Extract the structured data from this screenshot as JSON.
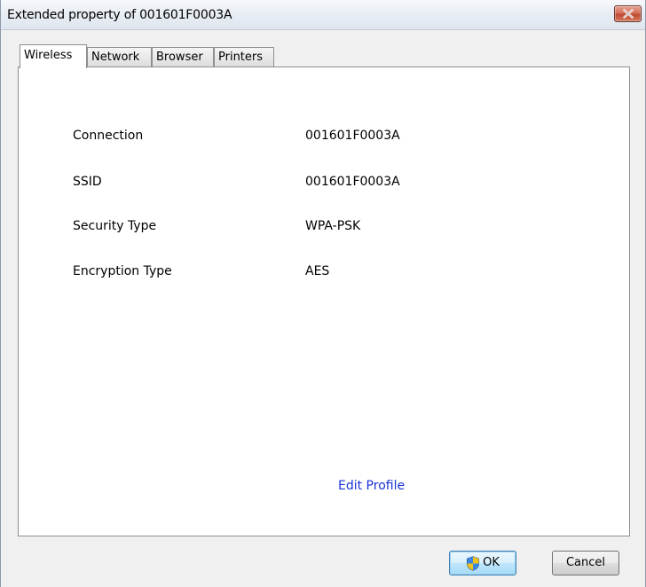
{
  "window": {
    "title": "Extended property of 001601F0003A"
  },
  "tabs": [
    {
      "label": "Wireless",
      "active": true
    },
    {
      "label": "Network",
      "active": false
    },
    {
      "label": "Browser",
      "active": false
    },
    {
      "label": "Printers",
      "active": false
    }
  ],
  "properties": [
    {
      "label": "Connection",
      "value": "001601F0003A"
    },
    {
      "label": "SSID",
      "value": "001601F0003A"
    },
    {
      "label": "Security Type",
      "value": "WPA-PSK"
    },
    {
      "label": "Encryption Type",
      "value": "AES"
    }
  ],
  "edit_profile_label": "Edit Profile",
  "buttons": {
    "ok_label": "OK",
    "cancel_label": "Cancel"
  },
  "icons": {
    "close": "close-icon",
    "ok": "uac-shield-icon"
  },
  "colors": {
    "link": "#1a34d6",
    "close_button": "#c04a31",
    "ok_button_border": "#3c7fb1"
  }
}
